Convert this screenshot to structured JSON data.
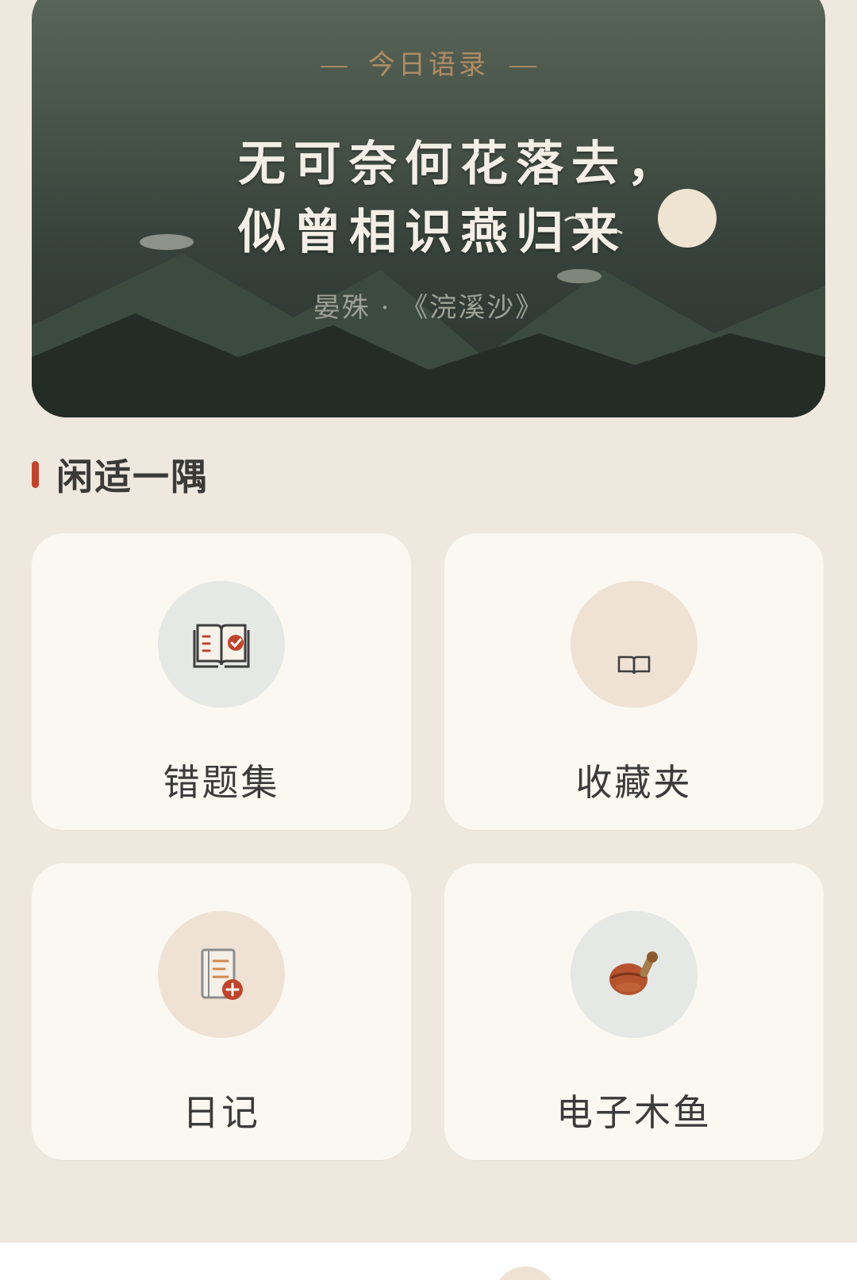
{
  "banner": {
    "label": "今日语录",
    "quote_line1": "无可奈何花落去，",
    "quote_line2": "似曾相识燕归来",
    "source": "晏殊 · 《浣溪沙》"
  },
  "section": {
    "title": "闲适一隅"
  },
  "tiles": [
    {
      "label": "错题集",
      "icon": "open-book-check-icon"
    },
    {
      "label": "收藏夹",
      "icon": "book-icon"
    },
    {
      "label": "日记",
      "icon": "notebook-add-icon"
    },
    {
      "label": "电子木鱼",
      "icon": "wooden-fish-icon"
    }
  ],
  "colors": {
    "accent": "#c0432c",
    "gold": "#b08c62",
    "background": "#efe8df",
    "tile": "#faf8f1"
  }
}
